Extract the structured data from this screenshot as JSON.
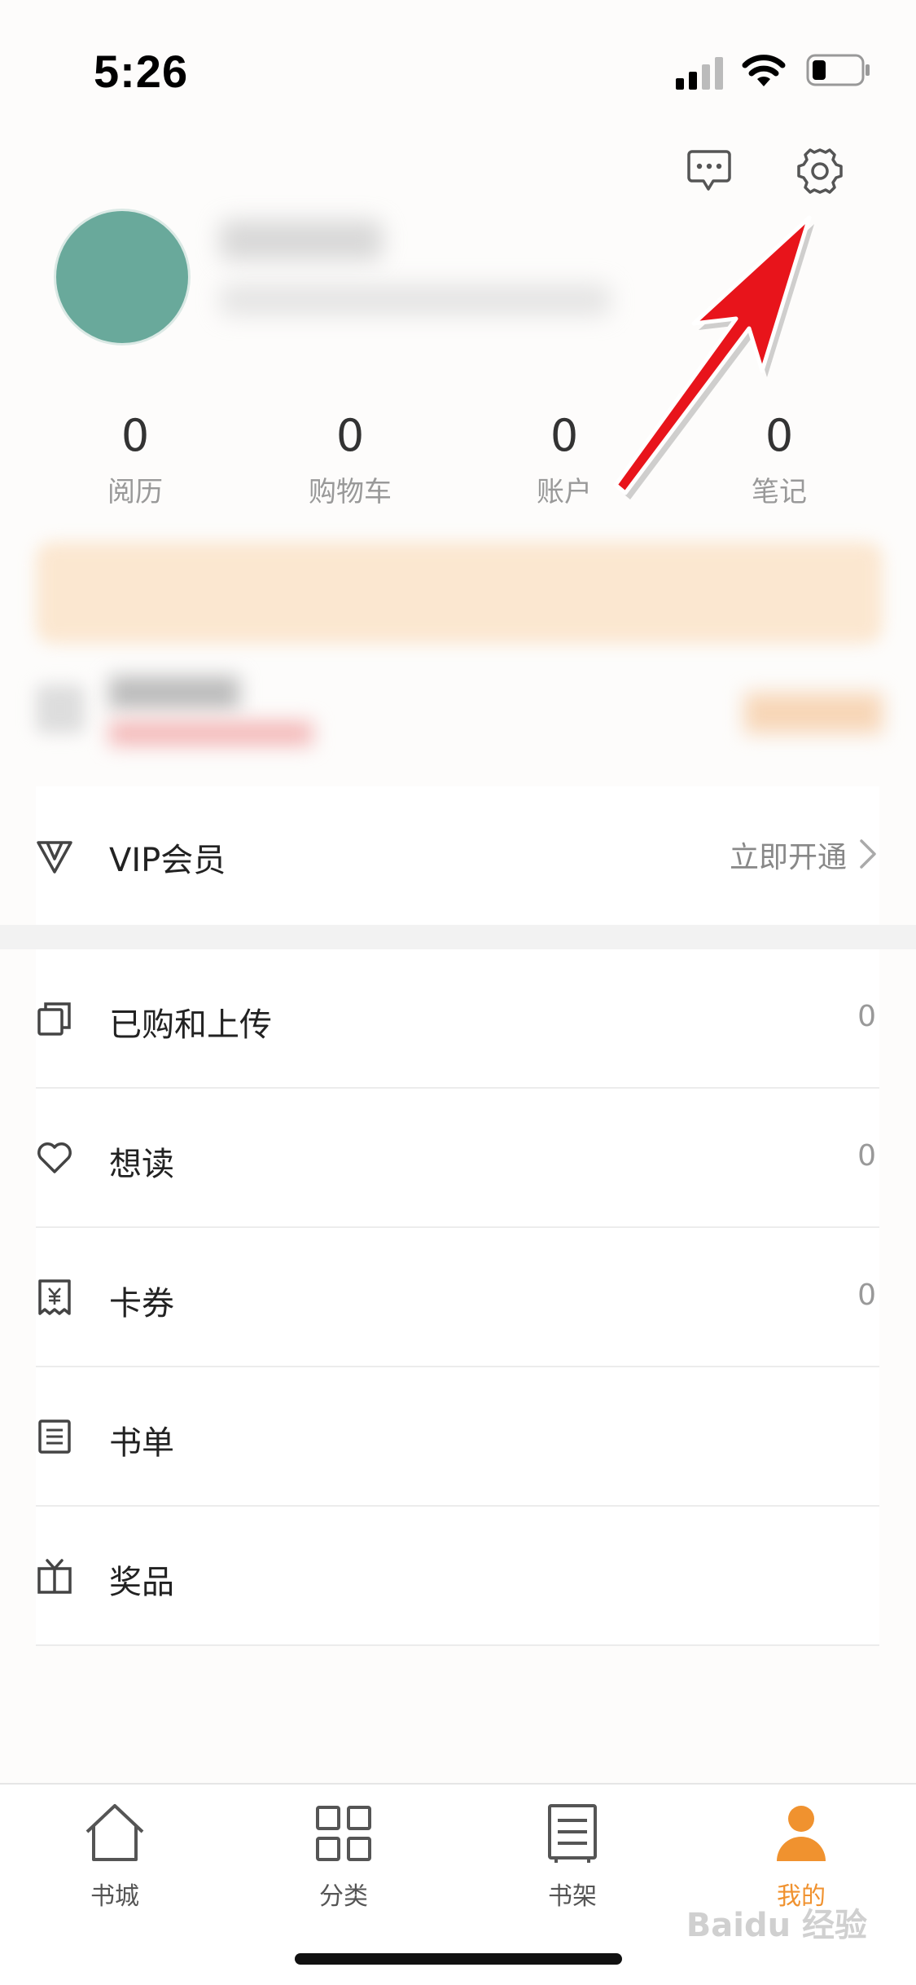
{
  "status_bar": {
    "time": "5:26"
  },
  "stats": [
    {
      "value": "0",
      "label": "阅历"
    },
    {
      "value": "0",
      "label": "购物车"
    },
    {
      "value": "0",
      "label": "账户"
    },
    {
      "value": "0",
      "label": "笔记"
    }
  ],
  "vip": {
    "label": "VIP会员",
    "action": "立即开通"
  },
  "menu": [
    {
      "label": "已购和上传",
      "count": "0",
      "icon": "stack-icon"
    },
    {
      "label": "想读",
      "count": "0",
      "icon": "heart-icon"
    },
    {
      "label": "卡券",
      "count": "0",
      "icon": "coupon-icon"
    },
    {
      "label": "书单",
      "count": "",
      "icon": "list-icon"
    },
    {
      "label": "奖品",
      "count": "",
      "icon": "gift-icon"
    }
  ],
  "tabs": [
    {
      "label": "书城",
      "icon": "home-icon"
    },
    {
      "label": "分类",
      "icon": "grid-icon"
    },
    {
      "label": "书架",
      "icon": "bookshelf-icon"
    },
    {
      "label": "我的",
      "icon": "person-icon",
      "active": true
    }
  ],
  "watermark": "Baidu 经验",
  "colors": {
    "accent": "#f0922f",
    "avatar": "#69a99b",
    "arrow": "#e8141b"
  }
}
